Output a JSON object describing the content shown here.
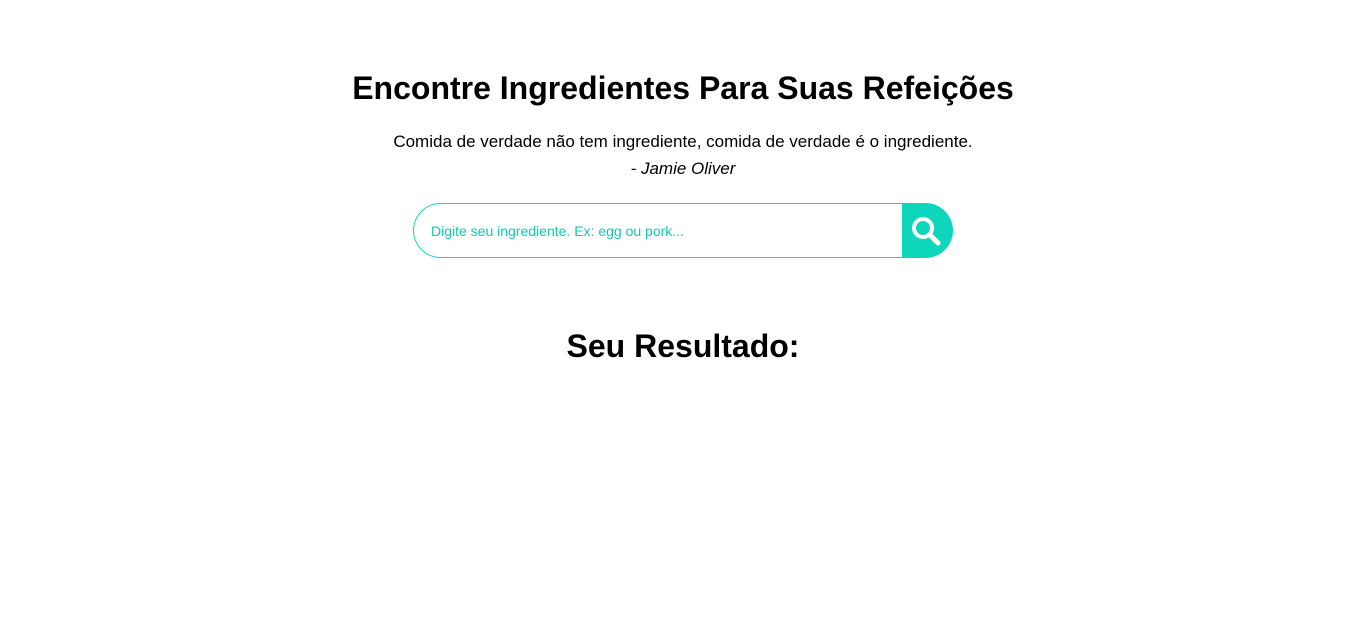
{
  "header": {
    "title": "Encontre Ingredientes Para Suas Refeições",
    "quote": "Comida de verdade não tem ingrediente, comida de verdade é o ingrediente.",
    "author": "- Jamie Oliver"
  },
  "search": {
    "placeholder": "Digite seu ingrediente. Ex: egg ou pork...",
    "value": "",
    "button_icon": "search-icon",
    "accent_color": "#0dd6bb"
  },
  "results": {
    "title": "Seu Resultado:"
  }
}
